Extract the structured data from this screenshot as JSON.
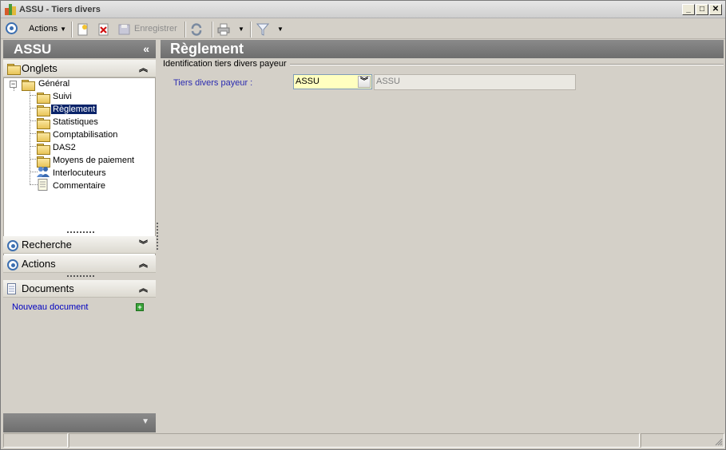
{
  "window": {
    "title": "ASSU -  Tiers divers",
    "minimize": "_",
    "maximize": "□",
    "close": "✕"
  },
  "toolbar": {
    "actions_label": "Actions",
    "save_label": "Enregistrer"
  },
  "left_panel": {
    "title": "ASSU",
    "collapse_glyph": "«",
    "sections": {
      "onglets": "Onglets",
      "recherche": "Recherche",
      "actions": "Actions",
      "documents": "Documents"
    },
    "tree": {
      "root": "Général",
      "items": [
        "Suivi",
        "Règlement",
        "Statistiques",
        "Comptabilisation",
        "DAS2",
        "Moyens de paiement",
        "Interlocuteurs",
        "Commentaire"
      ],
      "selected": "Règlement"
    },
    "new_document": "Nouveau document"
  },
  "main": {
    "title": "Règlement",
    "group_label": "Identification tiers divers payeur",
    "field_label": "Tiers divers payeur :",
    "combo_value": "ASSU",
    "readonly_value": "ASSU"
  },
  "colors": {
    "header_gray": "#7c7c7c",
    "selection": "#0a246a",
    "link_blue": "#0000c0",
    "combo_bg": "#ffffc0"
  },
  "icons": [
    "app-icon",
    "actions-circle-icon",
    "new-icon",
    "delete-icon",
    "save-icon",
    "refresh-icon",
    "print-icon",
    "filter-icon",
    "folder-icon",
    "people-icon",
    "note-icon",
    "add-icon"
  ]
}
